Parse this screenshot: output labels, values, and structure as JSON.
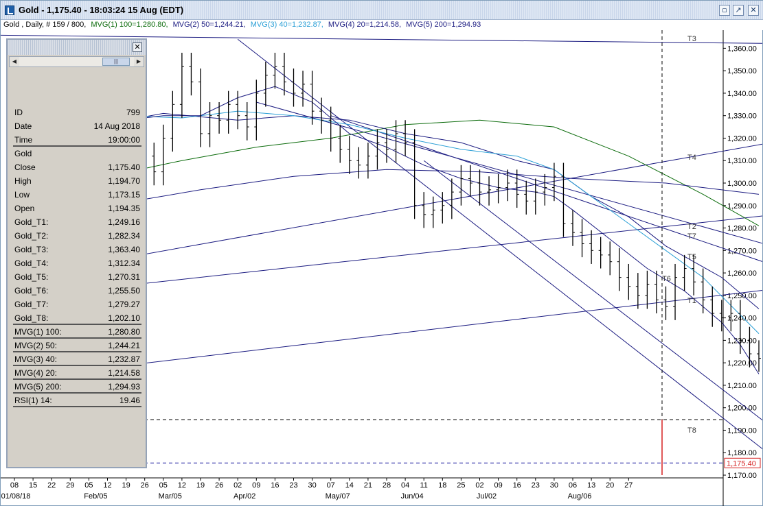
{
  "window": {
    "title": "Gold - 1,175.40 - 18:03:24  15 Aug (EDT)",
    "buttons": [
      "▫",
      "↗",
      "✕"
    ]
  },
  "infobar": {
    "instrument": "Gold , Daily, # 159 / 800,",
    "indicators": [
      {
        "text": "MVG(1) 100=1,280.80,",
        "color": "#0b6b0b"
      },
      {
        "text": "MVG(2) 50=1,244.21,",
        "color": "#1a1a80"
      },
      {
        "text": "MVG(3) 40=1,232.87,",
        "color": "#2a9fd6"
      },
      {
        "text": "MVG(4) 20=1,214.58,",
        "color": "#1a1a80"
      },
      {
        "text": "MVG(5) 200=1,294.93",
        "color": "#1a1a80"
      }
    ]
  },
  "panel": {
    "close_label": "✕",
    "scroll_left": "◀",
    "scroll_right": "▶",
    "scroll_thumb": "|||",
    "rows": [
      {
        "k": "ID",
        "v": "799"
      },
      {
        "k": "Date",
        "v": "14 Aug 2018"
      },
      {
        "k": "Time",
        "v": "19:00:00",
        "line": true
      },
      {
        "k": "Gold",
        "v": ""
      },
      {
        "k": "Close",
        "v": "1,175.40"
      },
      {
        "k": "High",
        "v": "1,194.70"
      },
      {
        "k": "Low",
        "v": "1,173.15"
      },
      {
        "k": "Open",
        "v": "1,194.35"
      },
      {
        "k": "Gold_T1:",
        "v": "1,249.16"
      },
      {
        "k": "Gold_T2:",
        "v": "1,282.34"
      },
      {
        "k": "Gold_T3:",
        "v": "1,363.40"
      },
      {
        "k": "Gold_T4:",
        "v": "1,312.34"
      },
      {
        "k": "Gold_T5:",
        "v": "1,270.31"
      },
      {
        "k": "Gold_T6:",
        "v": "1,255.50"
      },
      {
        "k": "Gold_T7:",
        "v": "1,279.27"
      },
      {
        "k": "Gold_T8:",
        "v": "1,202.10",
        "line": true
      },
      {
        "k": "MVG(1) 100:",
        "v": "1,280.80",
        "line": true
      },
      {
        "k": "MVG(2) 50:",
        "v": "1,244.21",
        "line": true
      },
      {
        "k": "MVG(3) 40:",
        "v": "1,232.87",
        "line": true
      },
      {
        "k": "MVG(4) 20:",
        "v": "1,214.58",
        "line": true
      },
      {
        "k": "MVG(5) 200:",
        "v": "1,294.93",
        "line": true
      },
      {
        "k": "RSI(1) 14:",
        "v": "19.46",
        "line": true
      }
    ]
  },
  "chart_data": {
    "type": "bar",
    "style": "ohlc",
    "ylim": [
      1170,
      1365
    ],
    "yticks": [
      1170,
      1180,
      1190,
      1200,
      1210,
      1220,
      1230,
      1240,
      1250,
      1260,
      1270,
      1280,
      1290,
      1300,
      1310,
      1320,
      1330,
      1340,
      1350,
      1360
    ],
    "ytick_labels": [
      "1,170.00",
      "1,180.00",
      "1,190.00",
      "1,200.00",
      "1,210.00",
      "1,220.00",
      "1,230.00",
      "1,240.00",
      "1,250.00",
      "1,260.00",
      "1,270.00",
      "1,280.00",
      "1,290.00",
      "1,300.00",
      "1,310.00",
      "1,320.00",
      "1,330.00",
      "1,340.00",
      "1,350.00",
      "1,360.00"
    ],
    "xticks": [
      "08",
      "15",
      "22",
      "29",
      "05",
      "12",
      "19",
      "26",
      "05",
      "12",
      "19",
      "26",
      "02",
      "09",
      "16",
      "23",
      "30",
      "07",
      "14",
      "21",
      "28",
      "04",
      "11",
      "18",
      "25",
      "02",
      "09",
      "16",
      "23",
      "30",
      "06",
      "13",
      "20",
      "27"
    ],
    "month_labels": [
      {
        "label": "01/08/18",
        "after_tick": 0
      },
      {
        "label": "Feb/05",
        "after_tick": 4
      },
      {
        "label": "Mar/05",
        "after_tick": 8
      },
      {
        "label": "Apr/02",
        "after_tick": 12
      },
      {
        "label": "May/07",
        "after_tick": 17
      },
      {
        "label": "Jun/04",
        "after_tick": 21
      },
      {
        "label": "Jul/02",
        "after_tick": 25
      },
      {
        "label": "Aug/06",
        "after_tick": 30
      }
    ],
    "last_price": 1175.4,
    "last_price_label": "1,175.40",
    "cursor_price": 1194.7,
    "price_series": [
      [
        0.0,
        1335
      ],
      [
        1.5,
        1318
      ],
      [
        2.0,
        1322
      ],
      [
        2.5,
        1327
      ],
      [
        3.0,
        1310
      ],
      [
        3.5,
        1320
      ],
      [
        4.0,
        1330
      ],
      [
        4.5,
        1322
      ],
      [
        5.0,
        1315
      ],
      [
        5.5,
        1320
      ],
      [
        6.0,
        1325
      ],
      [
        6.5,
        1308
      ],
      [
        7.0,
        1312
      ],
      [
        7.5,
        1305
      ],
      [
        8.0,
        1320
      ],
      [
        8.5,
        1335
      ],
      [
        9.0,
        1352
      ],
      [
        9.5,
        1345
      ],
      [
        10.0,
        1322
      ],
      [
        10.5,
        1330
      ],
      [
        11.0,
        1328
      ],
      [
        11.5,
        1335
      ],
      [
        12.0,
        1330
      ],
      [
        12.5,
        1325
      ],
      [
        13.0,
        1340
      ],
      [
        13.5,
        1348
      ],
      [
        14.0,
        1352
      ],
      [
        14.5,
        1345
      ],
      [
        15.0,
        1340
      ],
      [
        15.5,
        1344
      ],
      [
        16.0,
        1332
      ],
      [
        16.5,
        1328
      ],
      [
        17.0,
        1320
      ],
      [
        17.5,
        1315
      ],
      [
        18.0,
        1310
      ],
      [
        18.5,
        1308
      ],
      [
        19.0,
        1312
      ],
      [
        19.5,
        1318
      ],
      [
        20.0,
        1315
      ],
      [
        20.5,
        1322
      ],
      [
        21.0,
        1318
      ],
      [
        21.5,
        1290
      ],
      [
        22.0,
        1286
      ],
      [
        22.5,
        1288
      ],
      [
        23.0,
        1290
      ],
      [
        23.5,
        1296
      ],
      [
        24.0,
        1302
      ],
      [
        24.5,
        1300
      ],
      [
        25.0,
        1296
      ],
      [
        25.5,
        1297
      ],
      [
        26.0,
        1298
      ],
      [
        26.5,
        1300
      ],
      [
        27.0,
        1295
      ],
      [
        27.5,
        1292
      ],
      [
        28.0,
        1296
      ],
      [
        28.5,
        1298
      ],
      [
        29.0,
        1303
      ],
      [
        29.5,
        1282
      ],
      [
        30.0,
        1278
      ],
      [
        30.5,
        1273
      ],
      [
        31.0,
        1270
      ],
      [
        31.5,
        1268
      ],
      [
        32.0,
        1265
      ],
      [
        32.5,
        1258
      ],
      [
        33.0,
        1254
      ],
      [
        33.5,
        1250
      ],
      [
        34.0,
        1255
      ],
      [
        34.5,
        1248
      ],
      [
        35.0,
        1245
      ],
      [
        35.5,
        1258
      ],
      [
        36.0,
        1262
      ],
      [
        36.5,
        1256
      ],
      [
        37.0,
        1248
      ],
      [
        37.5,
        1242
      ],
      [
        38.0,
        1240
      ],
      [
        38.5,
        1242
      ],
      [
        39.0,
        1230
      ],
      [
        39.5,
        1224
      ],
      [
        40.0,
        1222
      ],
      [
        40.5,
        1225
      ],
      [
        41.0,
        1228
      ],
      [
        41.5,
        1230
      ],
      [
        42.0,
        1225
      ],
      [
        42.5,
        1222
      ],
      [
        43.0,
        1218
      ],
      [
        43.5,
        1215
      ],
      [
        44.0,
        1212
      ],
      [
        44.5,
        1210
      ],
      [
        45.0,
        1215
      ],
      [
        45.5,
        1212
      ],
      [
        46.0,
        1210
      ],
      [
        46.5,
        1208
      ],
      [
        47.0,
        1195
      ],
      [
        47.5,
        1193
      ],
      [
        48.0,
        1194
      ]
    ],
    "mavg": [
      {
        "name": "MVG(1) 100",
        "color": "#0b6b0b",
        "points": [
          [
            0,
            1298
          ],
          [
            5,
            1303
          ],
          [
            9,
            1310
          ],
          [
            13,
            1316
          ],
          [
            17,
            1320
          ],
          [
            21,
            1326
          ],
          [
            25,
            1328
          ],
          [
            29,
            1325
          ],
          [
            33,
            1312
          ],
          [
            37,
            1295
          ],
          [
            40,
            1281
          ]
        ]
      },
      {
        "name": "MVG(2) 50",
        "color": "#1a1a80",
        "points": [
          [
            0,
            1320
          ],
          [
            4,
            1325
          ],
          [
            8,
            1331
          ],
          [
            12,
            1328
          ],
          [
            15,
            1330
          ],
          [
            18,
            1328
          ],
          [
            21,
            1322
          ],
          [
            24,
            1318
          ],
          [
            27,
            1310
          ],
          [
            29,
            1306
          ],
          [
            31,
            1294
          ],
          [
            33,
            1285
          ],
          [
            35,
            1272
          ],
          [
            38,
            1258
          ],
          [
            40,
            1244
          ]
        ]
      },
      {
        "name": "MVG(3) 40",
        "color": "#2a9fd6",
        "points": [
          [
            0,
            1338
          ],
          [
            3,
            1334
          ],
          [
            6,
            1330
          ],
          [
            9,
            1329
          ],
          [
            12,
            1332
          ],
          [
            15,
            1330
          ],
          [
            18,
            1326
          ],
          [
            21,
            1320
          ],
          [
            24,
            1315
          ],
          [
            27,
            1312
          ],
          [
            29,
            1306
          ],
          [
            31,
            1294
          ],
          [
            33,
            1282
          ],
          [
            35,
            1270
          ],
          [
            37,
            1258
          ],
          [
            40,
            1233
          ]
        ]
      },
      {
        "name": "MVG(4) 20",
        "color": "#1a1a80",
        "points": [
          [
            0,
            1340
          ],
          [
            2,
            1330
          ],
          [
            4,
            1322
          ],
          [
            6,
            1328
          ],
          [
            8,
            1330
          ],
          [
            10,
            1330
          ],
          [
            12,
            1338
          ],
          [
            14,
            1343
          ],
          [
            16,
            1336
          ],
          [
            18,
            1322
          ],
          [
            20,
            1316
          ],
          [
            22,
            1308
          ],
          [
            24,
            1302
          ],
          [
            26,
            1298
          ],
          [
            28,
            1296
          ],
          [
            29,
            1294
          ],
          [
            30,
            1288
          ],
          [
            32,
            1275
          ],
          [
            34,
            1262
          ],
          [
            36,
            1252
          ],
          [
            38,
            1238
          ],
          [
            39,
            1228
          ],
          [
            40,
            1215
          ]
        ]
      },
      {
        "name": "MVG(5) 200",
        "color": "#1a1a80",
        "points": [
          [
            0,
            1285
          ],
          [
            5,
            1290
          ],
          [
            10,
            1297
          ],
          [
            15,
            1303
          ],
          [
            20,
            1306
          ],
          [
            25,
            1305
          ],
          [
            30,
            1302
          ],
          [
            35,
            1300
          ],
          [
            40,
            1295
          ]
        ]
      }
    ],
    "trendlines": [
      {
        "name": "T1",
        "color": "#1a1a80",
        "points": [
          [
            0,
            1213
          ],
          [
            42,
            1254
          ]
        ]
      },
      {
        "name": "T2",
        "color": "#1a1a80",
        "points": [
          [
            0,
            1249
          ],
          [
            42,
            1287
          ]
        ]
      },
      {
        "name": "T3",
        "color": "#1a1a80",
        "points": [
          [
            -3,
            1366
          ],
          [
            42,
            1362
          ]
        ]
      },
      {
        "name": "T4",
        "color": "#1a1a80",
        "points": [
          [
            0,
            1258
          ],
          [
            42,
            1320
          ]
        ]
      },
      {
        "name": "T5",
        "color": "#1a1a80",
        "points": [
          [
            13,
            1336
          ],
          [
            42,
            1269
          ]
        ]
      },
      {
        "name": "T6",
        "color": "#1a1a80",
        "points": [
          [
            12,
            1364
          ],
          [
            42,
            1170
          ]
        ]
      },
      {
        "name": "T7",
        "color": "#1a1a80",
        "points": [
          [
            17,
            1330
          ],
          [
            42,
            1260
          ]
        ]
      },
      {
        "name": "T8",
        "color": "#1a1a80",
        "points": [
          [
            22,
            1310
          ],
          [
            42,
            1183
          ]
        ]
      }
    ],
    "trend_labels": [
      "T1",
      "T2",
      "T3",
      "T4",
      "T5",
      "T6",
      "T7",
      "T8"
    ]
  }
}
